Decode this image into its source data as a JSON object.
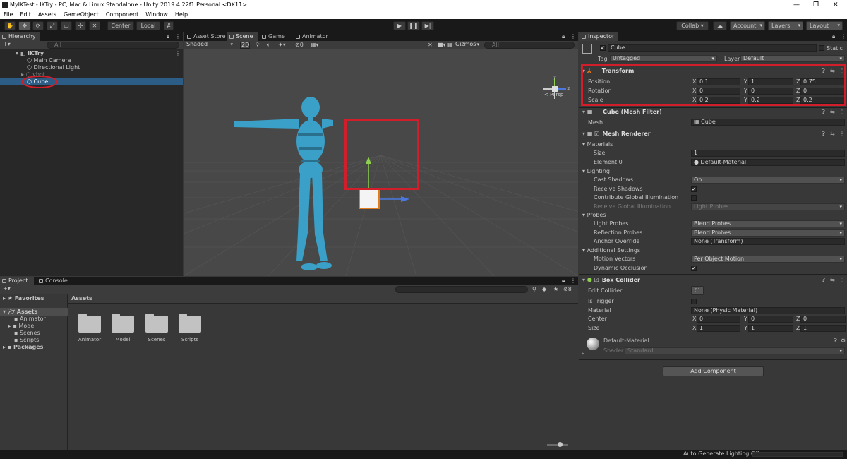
{
  "window": {
    "title": "MyIKTest - IKTry - PC, Mac & Linux Standalone - Unity 2019.4.22f1 Personal <DX11>",
    "minimize": "—",
    "maximize": "❐",
    "close": "✕"
  },
  "menu": [
    "File",
    "Edit",
    "Assets",
    "GameObject",
    "Component",
    "Window",
    "Help"
  ],
  "toolbar": {
    "pivot": "Center",
    "space": "Local",
    "play": "▶",
    "pause": "❚❚",
    "step": "▶|",
    "collab": "Collab ▾",
    "account": "Account",
    "layers": "Layers",
    "layout": "Layout"
  },
  "hierarchy": {
    "tab": "Hierarchy",
    "search_placeholder": "All",
    "scene": "IKTry",
    "items": [
      "Main Camera",
      "Directional Light",
      "ybot",
      "Cube"
    ]
  },
  "scene_tabs": [
    "Asset Store",
    "Scene",
    "Game",
    "Animator"
  ],
  "scene_toolbar": {
    "shading": "Shaded",
    "mode2d": "2D",
    "fx_count": "0",
    "gizmos": "Gizmos",
    "search_placeholder": "All",
    "persp": "< Persp",
    "axis_y": "y",
    "axis_z": "z"
  },
  "project": {
    "tabs": [
      "Project",
      "Console"
    ],
    "favorites": "Favorites",
    "assets": "Assets",
    "tree": [
      "Animator",
      "Model",
      "Scenes",
      "Scripts"
    ],
    "packages": "Packages",
    "breadcrumb": "Assets",
    "folders": [
      "Animator",
      "Model",
      "Scenes",
      "Scripts"
    ],
    "hidden_count": "8"
  },
  "inspector": {
    "tab": "Inspector",
    "object_name": "Cube",
    "static_label": "Static",
    "tag_label": "Tag",
    "tag_value": "Untagged",
    "layer_label": "Layer",
    "layer_value": "Default",
    "transform": {
      "title": "Transform",
      "rows": [
        {
          "label": "Position",
          "x": "0.1",
          "y": "1",
          "z": "0.75"
        },
        {
          "label": "Rotation",
          "x": "0",
          "y": "0",
          "z": "0"
        },
        {
          "label": "Scale",
          "x": "0.2",
          "y": "0.2",
          "z": "0.2"
        }
      ]
    },
    "mesh_filter": {
      "title": "Cube (Mesh Filter)",
      "mesh_label": "Mesh",
      "mesh_value": "Cube"
    },
    "mesh_renderer": {
      "title": "Mesh Renderer",
      "materials": "Materials",
      "size_label": "Size",
      "size_value": "1",
      "element_label": "Element 0",
      "element_value": "Default-Material",
      "lighting": "Lighting",
      "cast_shadows_label": "Cast Shadows",
      "cast_shadows_value": "On",
      "receive_shadows": "Receive Shadows",
      "contribute_gi": "Contribute Global Illumination",
      "receive_gi_label": "Receive Global Illumination",
      "receive_gi_value": "Light Probes",
      "probes": "Probes",
      "light_probes_label": "Light Probes",
      "light_probes_value": "Blend Probes",
      "reflection_probes_label": "Reflection Probes",
      "reflection_probes_value": "Blend Probes",
      "anchor_label": "Anchor Override",
      "anchor_value": "None (Transform)",
      "additional": "Additional Settings",
      "motion_label": "Motion Vectors",
      "motion_value": "Per Object Motion",
      "dynamic_occlusion": "Dynamic Occlusion"
    },
    "box_collider": {
      "title": "Box Collider",
      "edit_collider": "Edit Collider",
      "is_trigger": "Is Trigger",
      "material_label": "Material",
      "material_value": "None (Physic Material)",
      "center_label": "Center",
      "center": {
        "x": "0",
        "y": "0",
        "z": "0"
      },
      "size_label": "Size",
      "size": {
        "x": "1",
        "y": "1",
        "z": "1"
      }
    },
    "material": {
      "name": "Default-Material",
      "shader_label": "Shader",
      "shader_value": "Standard"
    },
    "add_component": "Add Component"
  },
  "status": {
    "text": "Auto Generate Lighting Off"
  },
  "axis": {
    "x": "X",
    "y": "Y",
    "z": "Z"
  },
  "colors": {
    "selection": "#2c5d87",
    "highlight": "#d21e2b",
    "character": "#3aa0c8",
    "y_axis": "#8fd14f",
    "x_axis": "#4a78e0"
  }
}
